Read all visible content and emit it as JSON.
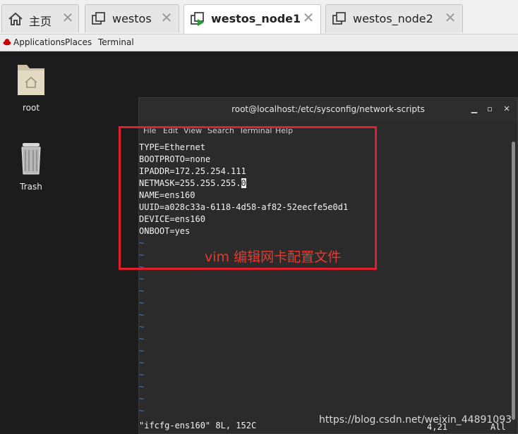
{
  "tabs": [
    {
      "label": "主页",
      "icon": "home-icon",
      "active": false
    },
    {
      "label": "westos",
      "icon": "vm-icon",
      "active": false
    },
    {
      "label": "westos_node1",
      "icon": "vm-running-icon",
      "active": true
    },
    {
      "label": "westos_node2",
      "icon": "vm-icon",
      "active": false
    }
  ],
  "topbar": {
    "applications": "Applications",
    "places": "Places",
    "terminal": "Terminal"
  },
  "desktop": {
    "root_label": "root",
    "trash_label": "Trash"
  },
  "terminal": {
    "title": "root@localhost:/etc/sysconfig/network-scripts",
    "menu": [
      "File",
      "Edit",
      "View",
      "Search",
      "Terminal",
      "Help"
    ],
    "lines": [
      "TYPE=Ethernet",
      "BOOTPROTO=none",
      "IPADDR=172.25.254.111",
      "NETMASK=255.255.255.",
      "NAME=ens160",
      "UUID=a028c33a-6118-4d58-af82-52eecfe5e0d1",
      "DEVICE=ens160",
      "ONBOOT=yes"
    ],
    "cursor_char": "0",
    "tilde": "~",
    "status_file": "\"ifcfg-ens160\" 8L, 152C",
    "status_pos": "4,21",
    "status_all": "All"
  },
  "annotation": "vim 编辑网卡配置文件",
  "watermark": "https://blog.csdn.net/weixin_44891093",
  "colors": {
    "annotation_red": "#e0202a",
    "tilde_blue": "#3f7fbf",
    "terminal_bg": "#2b2b2b"
  }
}
